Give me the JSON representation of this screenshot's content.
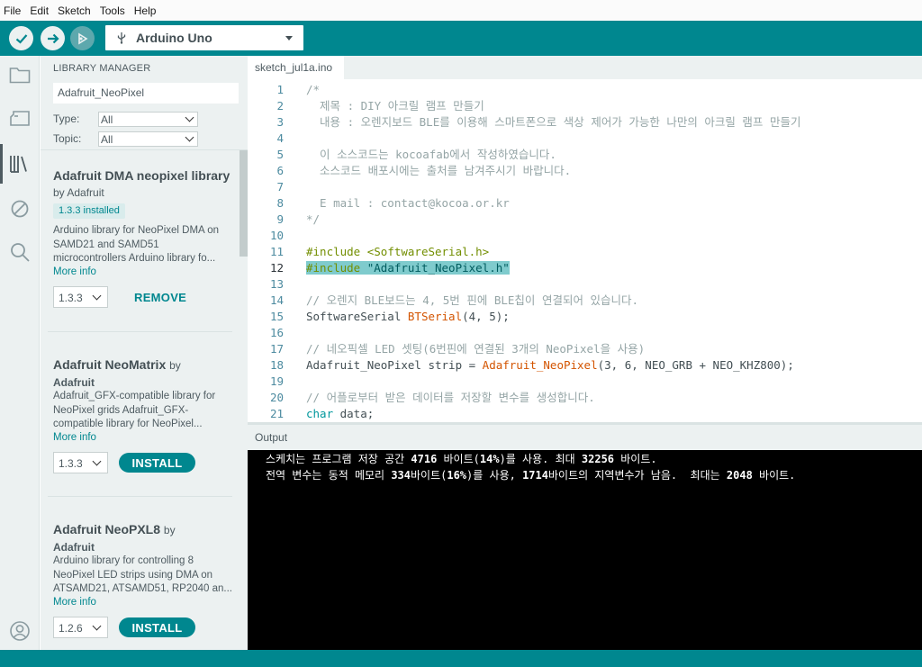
{
  "menu": [
    "File",
    "Edit",
    "Sketch",
    "Tools",
    "Help"
  ],
  "toolbar": {
    "board": "Arduino Uno"
  },
  "library_manager": {
    "title": "LIBRARY MANAGER",
    "search_value": "Adafruit_NeoPixel",
    "type_label": "Type:",
    "type_value": "All",
    "topic_label": "Topic:",
    "topic_value": "All",
    "items": [
      {
        "name": "Adafruit DMA neopixel library",
        "by": "by Adafruit",
        "installed": "1.3.3 installed",
        "description": "Arduino library for NeoPixel DMA on SAMD21 and SAMD51 microcontrollers Arduino library fo...",
        "more_info": "More info",
        "version": "1.3.3",
        "action": "REMOVE"
      },
      {
        "name": "Adafruit NeoMatrix",
        "by": "by",
        "author": "Adafruit",
        "description": "Adafruit_GFX-compatible library for NeoPixel grids Adafruit_GFX-compatible library for NeoPixel...",
        "more_info": "More info",
        "version": "1.3.3",
        "action": "INSTALL"
      },
      {
        "name": "Adafruit NeoPXL8",
        "by": "by",
        "author": "Adafruit",
        "description": "Arduino library for controlling 8 NeoPixel LED strips using DMA on ATSAMD21, ATSAMD51, RP2040 an...",
        "more_info": "More info",
        "version": "1.2.6",
        "action": "INSTALL"
      }
    ]
  },
  "editor": {
    "tab": "sketch_jul1a.ino",
    "current_line": 12,
    "lines": [
      {
        "n": "1",
        "t": "/*"
      },
      {
        "n": "2",
        "t": "  제목 : DIY 아크릴 램프 만들기"
      },
      {
        "n": "3",
        "t": "  내용 : 오렌지보드 BLE를 이용해 스마트폰으로 색상 제어가 가능한 나만의 아크릴 램프 만들기"
      },
      {
        "n": "4",
        "t": ""
      },
      {
        "n": "5",
        "t": "  이 소스코드는 kocoafab에서 작성하였습니다."
      },
      {
        "n": "6",
        "t": "  소스코드 배포시에는 출처를 남겨주시기 바랍니다."
      },
      {
        "n": "7",
        "t": ""
      },
      {
        "n": "8",
        "t": "  E mail : contact@kocoa.or.kr"
      },
      {
        "n": "9",
        "t": "*/"
      },
      {
        "n": "10",
        "t": ""
      },
      {
        "n": "11",
        "pp": "#include",
        "rest": " <SoftwareSerial.h>"
      },
      {
        "n": "12",
        "pp": "#include",
        "str": " \"Adafruit_NeoPixel.h\""
      },
      {
        "n": "13",
        "t": ""
      },
      {
        "n": "14",
        "t": "// 오렌지 BLE보드는 4, 5번 핀에 BLE칩이 연결되어 있습니다."
      },
      {
        "n": "15",
        "a": "SoftwareSerial ",
        "fn": "BTSerial",
        "b": "(4, 5);"
      },
      {
        "n": "16",
        "t": ""
      },
      {
        "n": "17",
        "t": "// 네오픽셀 LED 셋팅(6번핀에 연결된 3개의 NeoPixel을 사용)"
      },
      {
        "n": "18",
        "a": "Adafruit_NeoPixel strip = ",
        "fn": "Adafruit_NeoPixel",
        "b": "(3, 6, NEO_GRB + NEO_KHZ800);"
      },
      {
        "n": "19",
        "t": ""
      },
      {
        "n": "20",
        "t": "// 어플로부터 받은 데이터를 저장할 변수를 생성합니다."
      },
      {
        "n": "21",
        "kw": "char",
        "b": " data;"
      }
    ]
  },
  "output": {
    "title": "Output",
    "line1_a": "스케치는 프로그램 저장 공간 ",
    "line1_b": "4716",
    "line1_c": " 바이트(",
    "line1_d": "14%",
    "line1_e": ")를 사용. 최대 ",
    "line1_f": "32256",
    "line1_g": " 바이트.",
    "line2_a": "전역 변수는 동적 메모리 ",
    "line2_b": "334",
    "line2_c": "바이트(",
    "line2_d": "16%",
    "line2_e": ")를 사용, ",
    "line2_f": "1714",
    "line2_g": "바이트의 지역변수가 남음.  최대는 ",
    "line2_h": "2048",
    "line2_i": " 바이트."
  }
}
